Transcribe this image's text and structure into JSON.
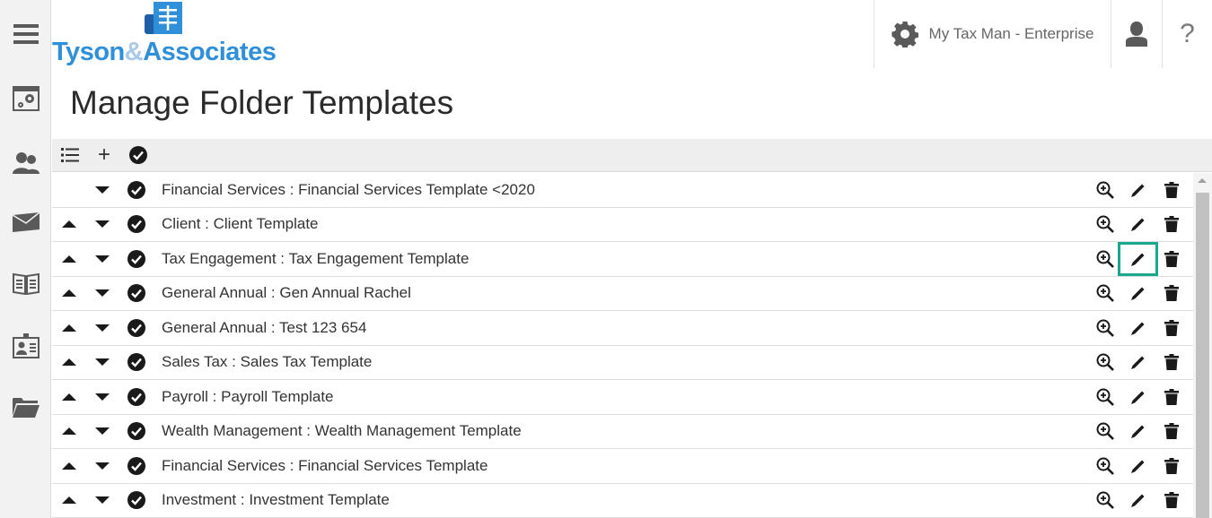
{
  "header": {
    "logo": {
      "part1": "Tyson",
      "part2": "&",
      "part3": "Associates",
      "mark_glyph": "丰"
    },
    "app_name": "My Tax Man - Enterprise",
    "help_label": "?"
  },
  "page": {
    "title": "Manage Folder Templates"
  },
  "toolbar": {
    "add_label": "+"
  },
  "sidebar": {
    "items": [
      {
        "name": "menu-icon"
      },
      {
        "name": "settings-window-icon"
      },
      {
        "name": "contacts-icon"
      },
      {
        "name": "mail-icon"
      },
      {
        "name": "newspaper-icon"
      },
      {
        "name": "id-card-icon"
      },
      {
        "name": "folder-icon"
      }
    ]
  },
  "templates": [
    {
      "label": "Financial Services : Financial Services Template <2020",
      "has_up": false
    },
    {
      "label": "Client : Client Template",
      "has_up": true
    },
    {
      "label": "Tax Engagement : Tax Engagement Template",
      "has_up": true,
      "edit_highlighted": true
    },
    {
      "label": "General Annual : Gen Annual Rachel",
      "has_up": true
    },
    {
      "label": "General Annual : Test 123 654",
      "has_up": true
    },
    {
      "label": "Sales Tax : Sales Tax Template",
      "has_up": true
    },
    {
      "label": "Payroll : Payroll Template",
      "has_up": true
    },
    {
      "label": "Wealth Management : Wealth Management Template",
      "has_up": true
    },
    {
      "label": "Financial Services : Financial Services Template",
      "has_up": true
    },
    {
      "label": "Investment : Investment Template",
      "has_up": true
    }
  ],
  "colors": {
    "highlight": "#1aa88d",
    "logo_blue": "#2f8fd8",
    "logo_light": "#a9c9e8"
  }
}
